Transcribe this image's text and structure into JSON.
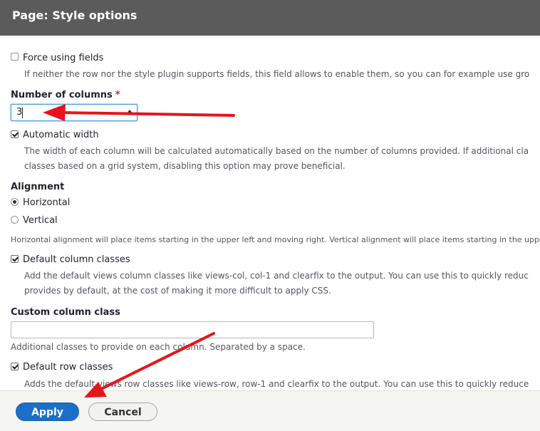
{
  "dialog": {
    "title": "Page: Style options"
  },
  "form": {
    "force_fields": {
      "label": "Force using fields",
      "checked": false,
      "description": "If neither the row nor the style plugin supports fields, this field allows to enable them, so you can for example use gro"
    },
    "columns": {
      "label": "Number of columns",
      "required_marker": "*",
      "value": "3"
    },
    "automatic_width": {
      "label": "Automatic width",
      "checked": true,
      "description_line1": "The width of each column will be calculated automatically based on the number of columns provided. If additional cla",
      "description_line2": "classes based on a grid system, disabling this option may prove beneficial."
    },
    "alignment": {
      "label": "Alignment",
      "options": [
        "Horizontal",
        "Vertical"
      ],
      "selected": "Horizontal",
      "description": "Horizontal alignment will place items starting in the upper left and moving right. Vertical alignment will place items starting in the uppe"
    },
    "default_column_classes": {
      "label": "Default column classes",
      "checked": true,
      "description_line1": "Add the default views column classes like views-col, col-1 and clearfix to the output. You can use this to quickly reduc",
      "description_line2": "provides by default, at the cost of making it more difficult to apply CSS."
    },
    "custom_column_class": {
      "label": "Custom column class",
      "value": "",
      "description": "Additional classes to provide on each column. Separated by a space."
    },
    "default_row_classes": {
      "label": "Default row classes",
      "checked": true,
      "description_line1": "Adds the default views row classes like views-row, row-1 and clearfix to the output. You can use this to quickly reduce"
    }
  },
  "footer": {
    "apply_label": "Apply",
    "cancel_label": "Cancel"
  },
  "colors": {
    "titlebar": "#5b5b5b",
    "primary_button": "#1b6fc9",
    "annotation_arrow": "#e8141c",
    "required": "#dc2323"
  }
}
